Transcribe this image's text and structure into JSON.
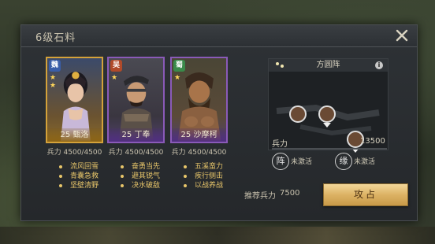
{
  "window": {
    "title": "6级石料"
  },
  "generals": [
    {
      "faction": "魏",
      "level_name": "25 甄洛",
      "troops_label": "兵力",
      "troops_value": "4500/4500",
      "skills": [
        "流风回雪",
        "青囊急救",
        "坚壁清野"
      ],
      "stars": [
        "★",
        "★"
      ],
      "quality_color": "#d4a23a"
    },
    {
      "faction": "吴",
      "level_name": "25 丁奉",
      "troops_label": "兵力",
      "troops_value": "4500/4500",
      "skills": [
        "奋勇当先",
        "避其锐气",
        "决水破敌"
      ],
      "stars": [
        "★"
      ],
      "quality_color": "#8a5ab8"
    },
    {
      "faction": "蜀",
      "level_name": "25 沙摩柯",
      "troops_label": "兵力",
      "troops_value": "4500/4500",
      "skills": [
        "五溪蛮力",
        "疾行侧击",
        "以战养战"
      ],
      "stars": [
        "★"
      ],
      "quality_color": "#8a5ab8"
    }
  ],
  "formation": {
    "name": "方圆阵",
    "info_icon": "i",
    "troops_label": "兵力",
    "troops_value": "13500",
    "bonds": [
      {
        "glyph": "阵",
        "status": "未激活"
      },
      {
        "glyph": "缘",
        "status": "未激活"
      }
    ]
  },
  "footer": {
    "recommended_label": "推荐兵力",
    "recommended_value": "7500",
    "attack_label": "攻占"
  },
  "icons": {
    "close": "close-icon",
    "info": "info-icon",
    "formation": "formation-dots-icon"
  }
}
